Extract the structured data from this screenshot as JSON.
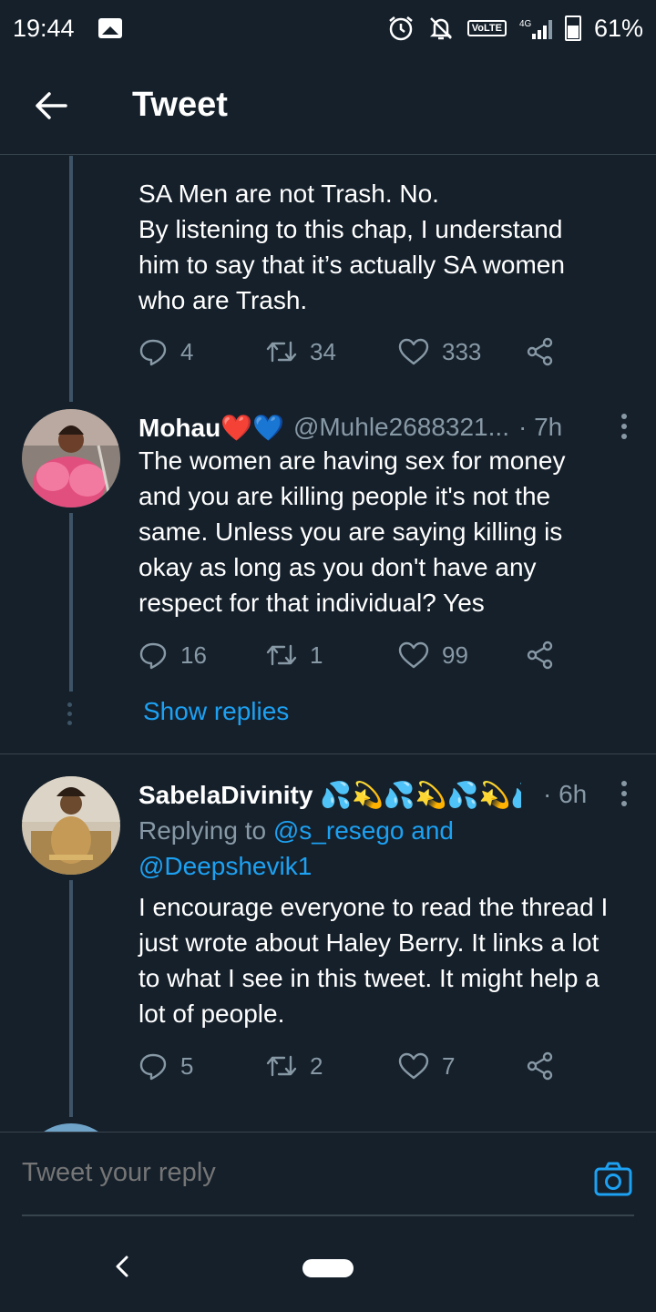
{
  "status": {
    "time": "19:44",
    "volte": "VoLTE",
    "network": "4G",
    "battery": "61%"
  },
  "header": {
    "title": "Tweet"
  },
  "parent_tweet": {
    "text_lines": [
      "SA Men are not Trash. No.",
      "By listening to this chap, I understand",
      "him to say that it’s actually SA women",
      "who are Trash."
    ],
    "replies": "4",
    "retweets": "34",
    "likes": "333"
  },
  "reply1": {
    "name": "Mohau❤️💙",
    "handle": "@Muhle2688321...",
    "time": "· 7h",
    "text_lines": [
      "The women are having sex for money",
      "and you are killing people it's not the",
      "same. Unless you are saying killing is",
      "okay as long as you don't have any",
      "respect for that individual? Yes"
    ],
    "replies": "16",
    "retweets": "1",
    "likes": "99",
    "show_replies": "Show replies"
  },
  "reply2": {
    "name": "SabelaDivinity 💦💫💦💫💦💫💦💫💦💫...",
    "time": "· 6h",
    "replying_prefix": "Replying to ",
    "replying_user1": "@s_resego",
    "replying_and": " and",
    "replying_user2": "@Deepshevik1",
    "text_lines": [
      "I encourage everyone to read the thread I",
      "just wrote about Haley Berry. It links a lot",
      "to what I see in this tweet. It might help a",
      "lot of people."
    ],
    "replies": "5",
    "retweets": "2",
    "likes": "7"
  },
  "composer": {
    "placeholder": "Tweet your reply"
  },
  "colors": {
    "background": "#15202b",
    "accent": "#1da1f2",
    "secondary_text": "#8899a6"
  },
  "icons": [
    "back-arrow-icon",
    "reply-icon",
    "retweet-icon",
    "like-icon",
    "share-icon",
    "more-icon",
    "camera-icon",
    "alarm-icon",
    "mute-icon"
  ]
}
